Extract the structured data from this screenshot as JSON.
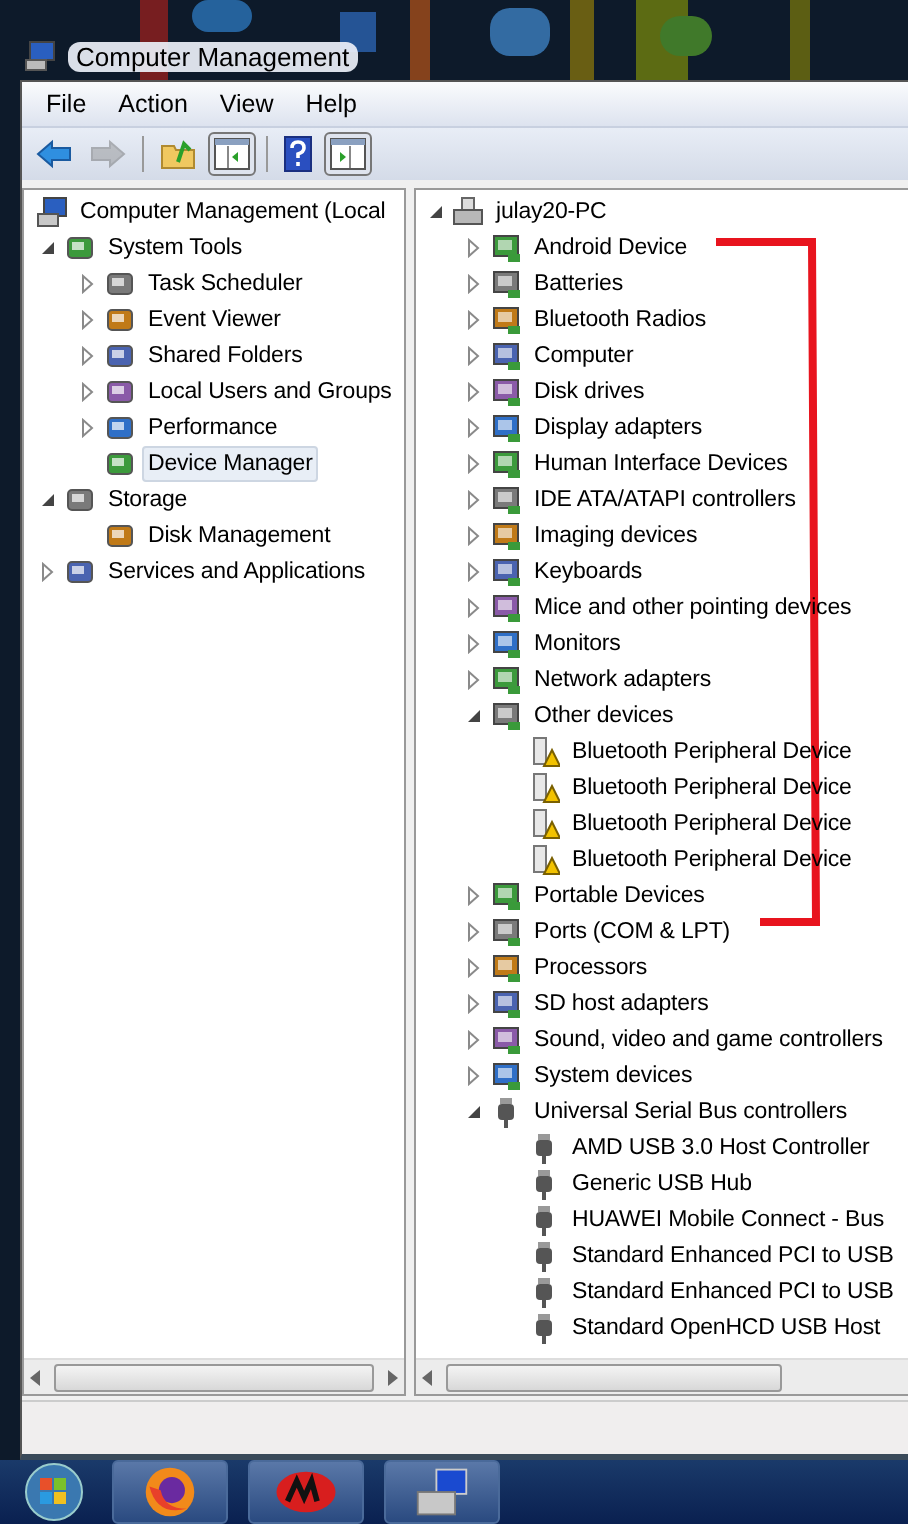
{
  "window": {
    "title": "Computer Management"
  },
  "menu": [
    "File",
    "Action",
    "View",
    "Help"
  ],
  "toolbar": [
    {
      "kind": "back",
      "disabled": false
    },
    {
      "kind": "forward",
      "disabled": true
    },
    {
      "kind": "up",
      "disabled": false
    },
    {
      "kind": "tree",
      "disabled": false
    },
    {
      "kind": "help",
      "disabled": false
    },
    {
      "kind": "action",
      "disabled": false
    }
  ],
  "left_tree": [
    {
      "label": "Computer Management (Local",
      "selected": false,
      "children": [
        {
          "label": "System Tools",
          "expanded": true,
          "selected": false,
          "children": [
            {
              "label": "Task Scheduler",
              "expanded": false,
              "selected": false
            },
            {
              "label": "Event Viewer",
              "expanded": false,
              "selected": false
            },
            {
              "label": "Shared Folders",
              "expanded": false,
              "selected": false
            },
            {
              "label": "Local Users and Groups",
              "expanded": false,
              "selected": false
            },
            {
              "label": "Performance",
              "expanded": false,
              "selected": false
            },
            {
              "label": "Device Manager",
              "selected": true
            }
          ]
        },
        {
          "label": "Storage",
          "expanded": true,
          "selected": false,
          "children": [
            {
              "label": "Disk Management",
              "selected": false
            }
          ]
        },
        {
          "label": "Services and Applications",
          "expanded": false,
          "selected": false
        }
      ]
    }
  ],
  "right_tree": [
    {
      "label": "julay20-PC",
      "expanded": true,
      "kind": "computer",
      "children": [
        {
          "label": "Android Device",
          "expanded": false,
          "kind": "device"
        },
        {
          "label": "Batteries",
          "expanded": false,
          "kind": "device"
        },
        {
          "label": "Bluetooth Radios",
          "expanded": false,
          "kind": "device"
        },
        {
          "label": "Computer",
          "expanded": false,
          "kind": "device"
        },
        {
          "label": "Disk drives",
          "expanded": false,
          "kind": "device"
        },
        {
          "label": "Display adapters",
          "expanded": false,
          "kind": "device"
        },
        {
          "label": "Human Interface Devices",
          "expanded": false,
          "kind": "device"
        },
        {
          "label": "IDE ATA/ATAPI controllers",
          "expanded": false,
          "kind": "device"
        },
        {
          "label": "Imaging devices",
          "expanded": false,
          "kind": "device"
        },
        {
          "label": "Keyboards",
          "expanded": false,
          "kind": "device"
        },
        {
          "label": "Mice and other pointing devices",
          "expanded": false,
          "kind": "device"
        },
        {
          "label": "Monitors",
          "expanded": false,
          "kind": "device"
        },
        {
          "label": "Network adapters",
          "expanded": false,
          "kind": "device"
        },
        {
          "label": "Other devices",
          "expanded": true,
          "kind": "device",
          "children": [
            {
              "label": "Bluetooth Peripheral Device",
              "kind": "warning"
            },
            {
              "label": "Bluetooth Peripheral Device",
              "kind": "warning"
            },
            {
              "label": "Bluetooth Peripheral Device",
              "kind": "warning"
            },
            {
              "label": "Bluetooth Peripheral Device",
              "kind": "warning"
            }
          ]
        },
        {
          "label": "Portable Devices",
          "expanded": false,
          "kind": "device"
        },
        {
          "label": "Ports (COM & LPT)",
          "expanded": false,
          "kind": "device"
        },
        {
          "label": "Processors",
          "expanded": false,
          "kind": "device"
        },
        {
          "label": "SD host adapters",
          "expanded": false,
          "kind": "device"
        },
        {
          "label": "Sound, video and game controllers",
          "expanded": false,
          "kind": "device"
        },
        {
          "label": "System devices",
          "expanded": false,
          "kind": "device"
        },
        {
          "label": "Universal Serial Bus controllers",
          "expanded": true,
          "kind": "usb",
          "children": [
            {
              "label": "AMD USB 3.0 Host Controller",
              "kind": "usb"
            },
            {
              "label": "Generic USB Hub",
              "kind": "usb"
            },
            {
              "label": "HUAWEI Mobile Connect - Bus",
              "kind": "usb"
            },
            {
              "label": "Standard Enhanced PCI to USB",
              "kind": "usb"
            },
            {
              "label": "Standard Enhanced PCI to USB",
              "kind": "usb"
            },
            {
              "label": "Standard OpenHCD USB Host",
              "kind": "usb"
            }
          ]
        }
      ]
    }
  ],
  "taskbar": [
    {
      "kind": "start"
    },
    {
      "kind": "browser"
    },
    {
      "kind": "app"
    },
    {
      "kind": "management"
    }
  ]
}
